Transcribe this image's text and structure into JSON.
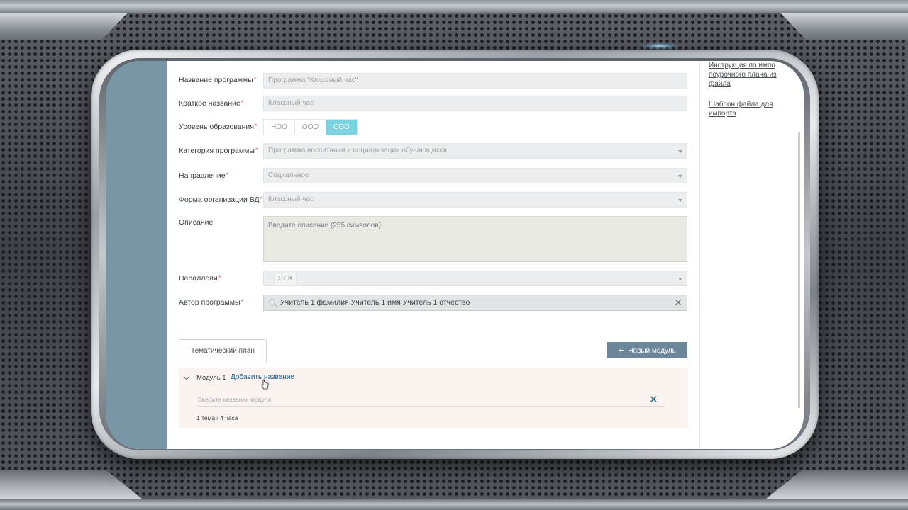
{
  "right_panel": {
    "link_instruction": "Инструкция по импо поурочного плана из файла",
    "link_template": "Шаблон файла для импорта"
  },
  "form": {
    "program_name": {
      "label": "Название программы",
      "placeholder": "Программа \"Классный час\""
    },
    "short_name": {
      "label": "Краткое название",
      "placeholder": "Классный час"
    },
    "education_level": {
      "label": "Уровень образования",
      "options": [
        "НОО",
        "ООО",
        "СОО"
      ],
      "selected": "СОО"
    },
    "category": {
      "label": "Категория программы",
      "value": "Программа воспитания и социализации обучающихся"
    },
    "direction": {
      "label": "Направление",
      "value": "Социальное"
    },
    "org_form": {
      "label": "Форма организации ВД",
      "value": "Классный час"
    },
    "description": {
      "label": "Описание",
      "placeholder": "Введите описание (255 символов)"
    },
    "parallels": {
      "label": "Параллели",
      "chip": "10"
    },
    "author": {
      "label": "Автор программы",
      "value": "Учитель 1 фамилия Учитель 1 имя Учитель 1 отчество"
    },
    "required_mark": "*"
  },
  "tabs": {
    "thematic_plan": "Тематический план",
    "new_module_button": "Новый модуль"
  },
  "module": {
    "title": "Модуль 1",
    "add_name_link": "Добавить название",
    "name_placeholder": "Введите название модуля",
    "meta": "1 тема / 4 часа"
  },
  "icons": [
    "chevron-down-icon",
    "close-icon",
    "plus-icon",
    "search-icon",
    "cursor-hand-icon"
  ]
}
